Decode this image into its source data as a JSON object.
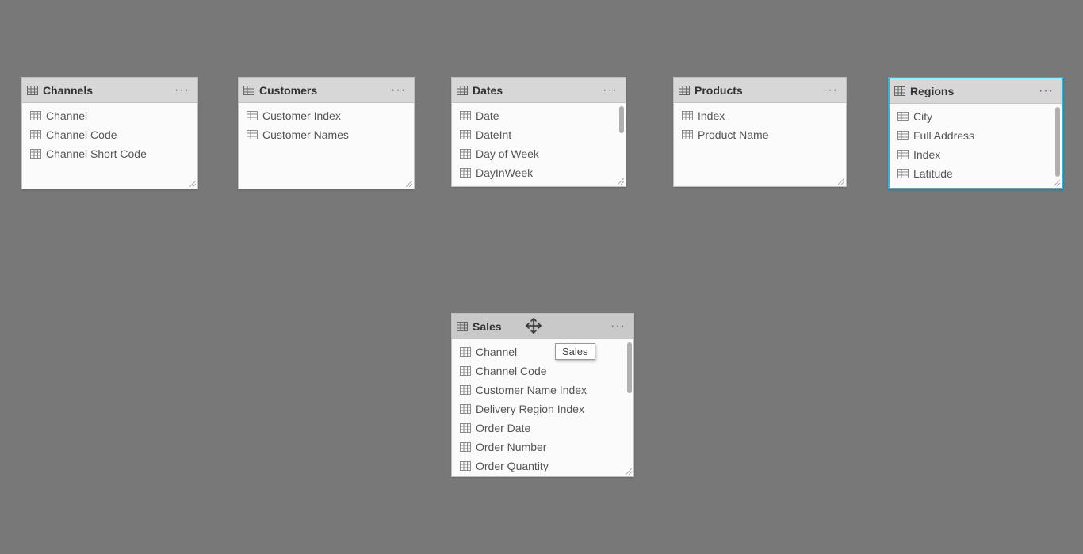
{
  "tables": {
    "channels": {
      "title": "Channels",
      "fields": [
        "Channel",
        "Channel Code",
        "Channel Short Code"
      ]
    },
    "customers": {
      "title": "Customers",
      "fields": [
        "Customer Index",
        "Customer Names"
      ]
    },
    "dates": {
      "title": "Dates",
      "fields": [
        "Date",
        "DateInt",
        "Day of Week",
        "DayInWeek"
      ]
    },
    "products": {
      "title": "Products",
      "fields": [
        "Index",
        "Product Name"
      ]
    },
    "regions": {
      "title": "Regions",
      "fields": [
        "City",
        "Full Address",
        "Index",
        "Latitude"
      ]
    },
    "sales": {
      "title": "Sales",
      "fields": [
        "Channel",
        "Channel Code",
        "Customer Name Index",
        "Delivery Region Index",
        "Order Date",
        "Order Number",
        "Order Quantity"
      ]
    }
  },
  "tooltip": "Sales"
}
